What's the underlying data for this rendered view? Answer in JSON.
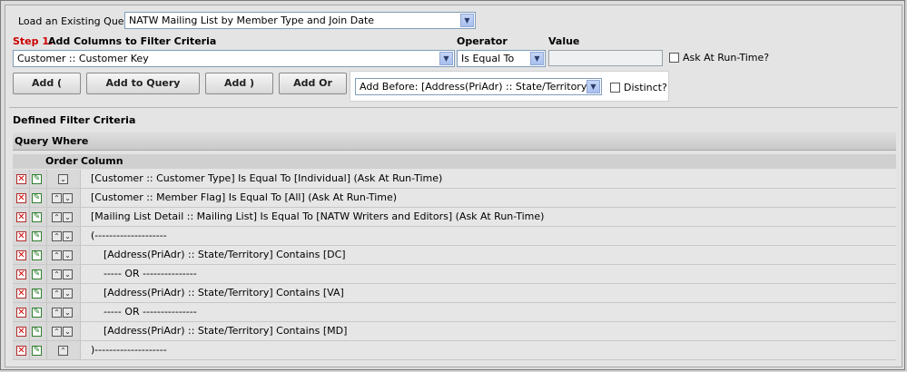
{
  "load_query": {
    "label": "Load an Existing Query:",
    "selected": "NATW Mailing List by Member Type and Join Date"
  },
  "step1": {
    "step_label": "Step 1:",
    "title": "Add Columns to Filter Criteria",
    "operator_header": "Operator",
    "value_header": "Value",
    "column_selected": "Customer :: Customer Key",
    "operator_selected": "Is Equal To",
    "value": "",
    "ask_runtime_label": "Ask At Run-Time?"
  },
  "buttons": {
    "add_paren": "Add (",
    "add_to_query": "Add to Query",
    "add_close_paren": "Add )",
    "add_or": "Add Or"
  },
  "add_before": {
    "selected": "Add Before: [Address(PriAdr) :: State/Territory...",
    "distinct_label": "Distinct?"
  },
  "defined": {
    "title": "Defined Filter Criteria",
    "query_where": "Query Where",
    "col_order": "Order",
    "col_column": "Column"
  },
  "rows": [
    {
      "text": "[Customer :: Customer Type] Is Equal To [Individual] (Ask At Run-Time)",
      "up": false,
      "down": true
    },
    {
      "text": "[Customer :: Member Flag] Is Equal To [All] (Ask At Run-Time)",
      "up": true,
      "down": true
    },
    {
      "text": "[Mailing List Detail :: Mailing List] Is Equal To [NATW Writers and Editors] (Ask At Run-Time)",
      "up": true,
      "down": true
    },
    {
      "text": "(--------------------",
      "up": true,
      "down": true
    },
    {
      "text": "    [Address(PriAdr) :: State/Territory] Contains [DC]",
      "up": true,
      "down": true
    },
    {
      "text": "    ----- OR ---------------",
      "up": true,
      "down": true
    },
    {
      "text": "    [Address(PriAdr) :: State/Territory] Contains [VA]",
      "up": true,
      "down": true
    },
    {
      "text": "    ----- OR ---------------",
      "up": true,
      "down": true
    },
    {
      "text": "    [Address(PriAdr) :: State/Territory] Contains [MD]",
      "up": true,
      "down": true
    },
    {
      "text": ")--------------------",
      "up": true,
      "down": false
    }
  ],
  "icons": {
    "delete": "delete-icon",
    "edit": "edit-icon",
    "move_up": "move-up-icon",
    "move_down": "move-down-icon"
  },
  "colors": {
    "step_red": "#cc0000"
  }
}
